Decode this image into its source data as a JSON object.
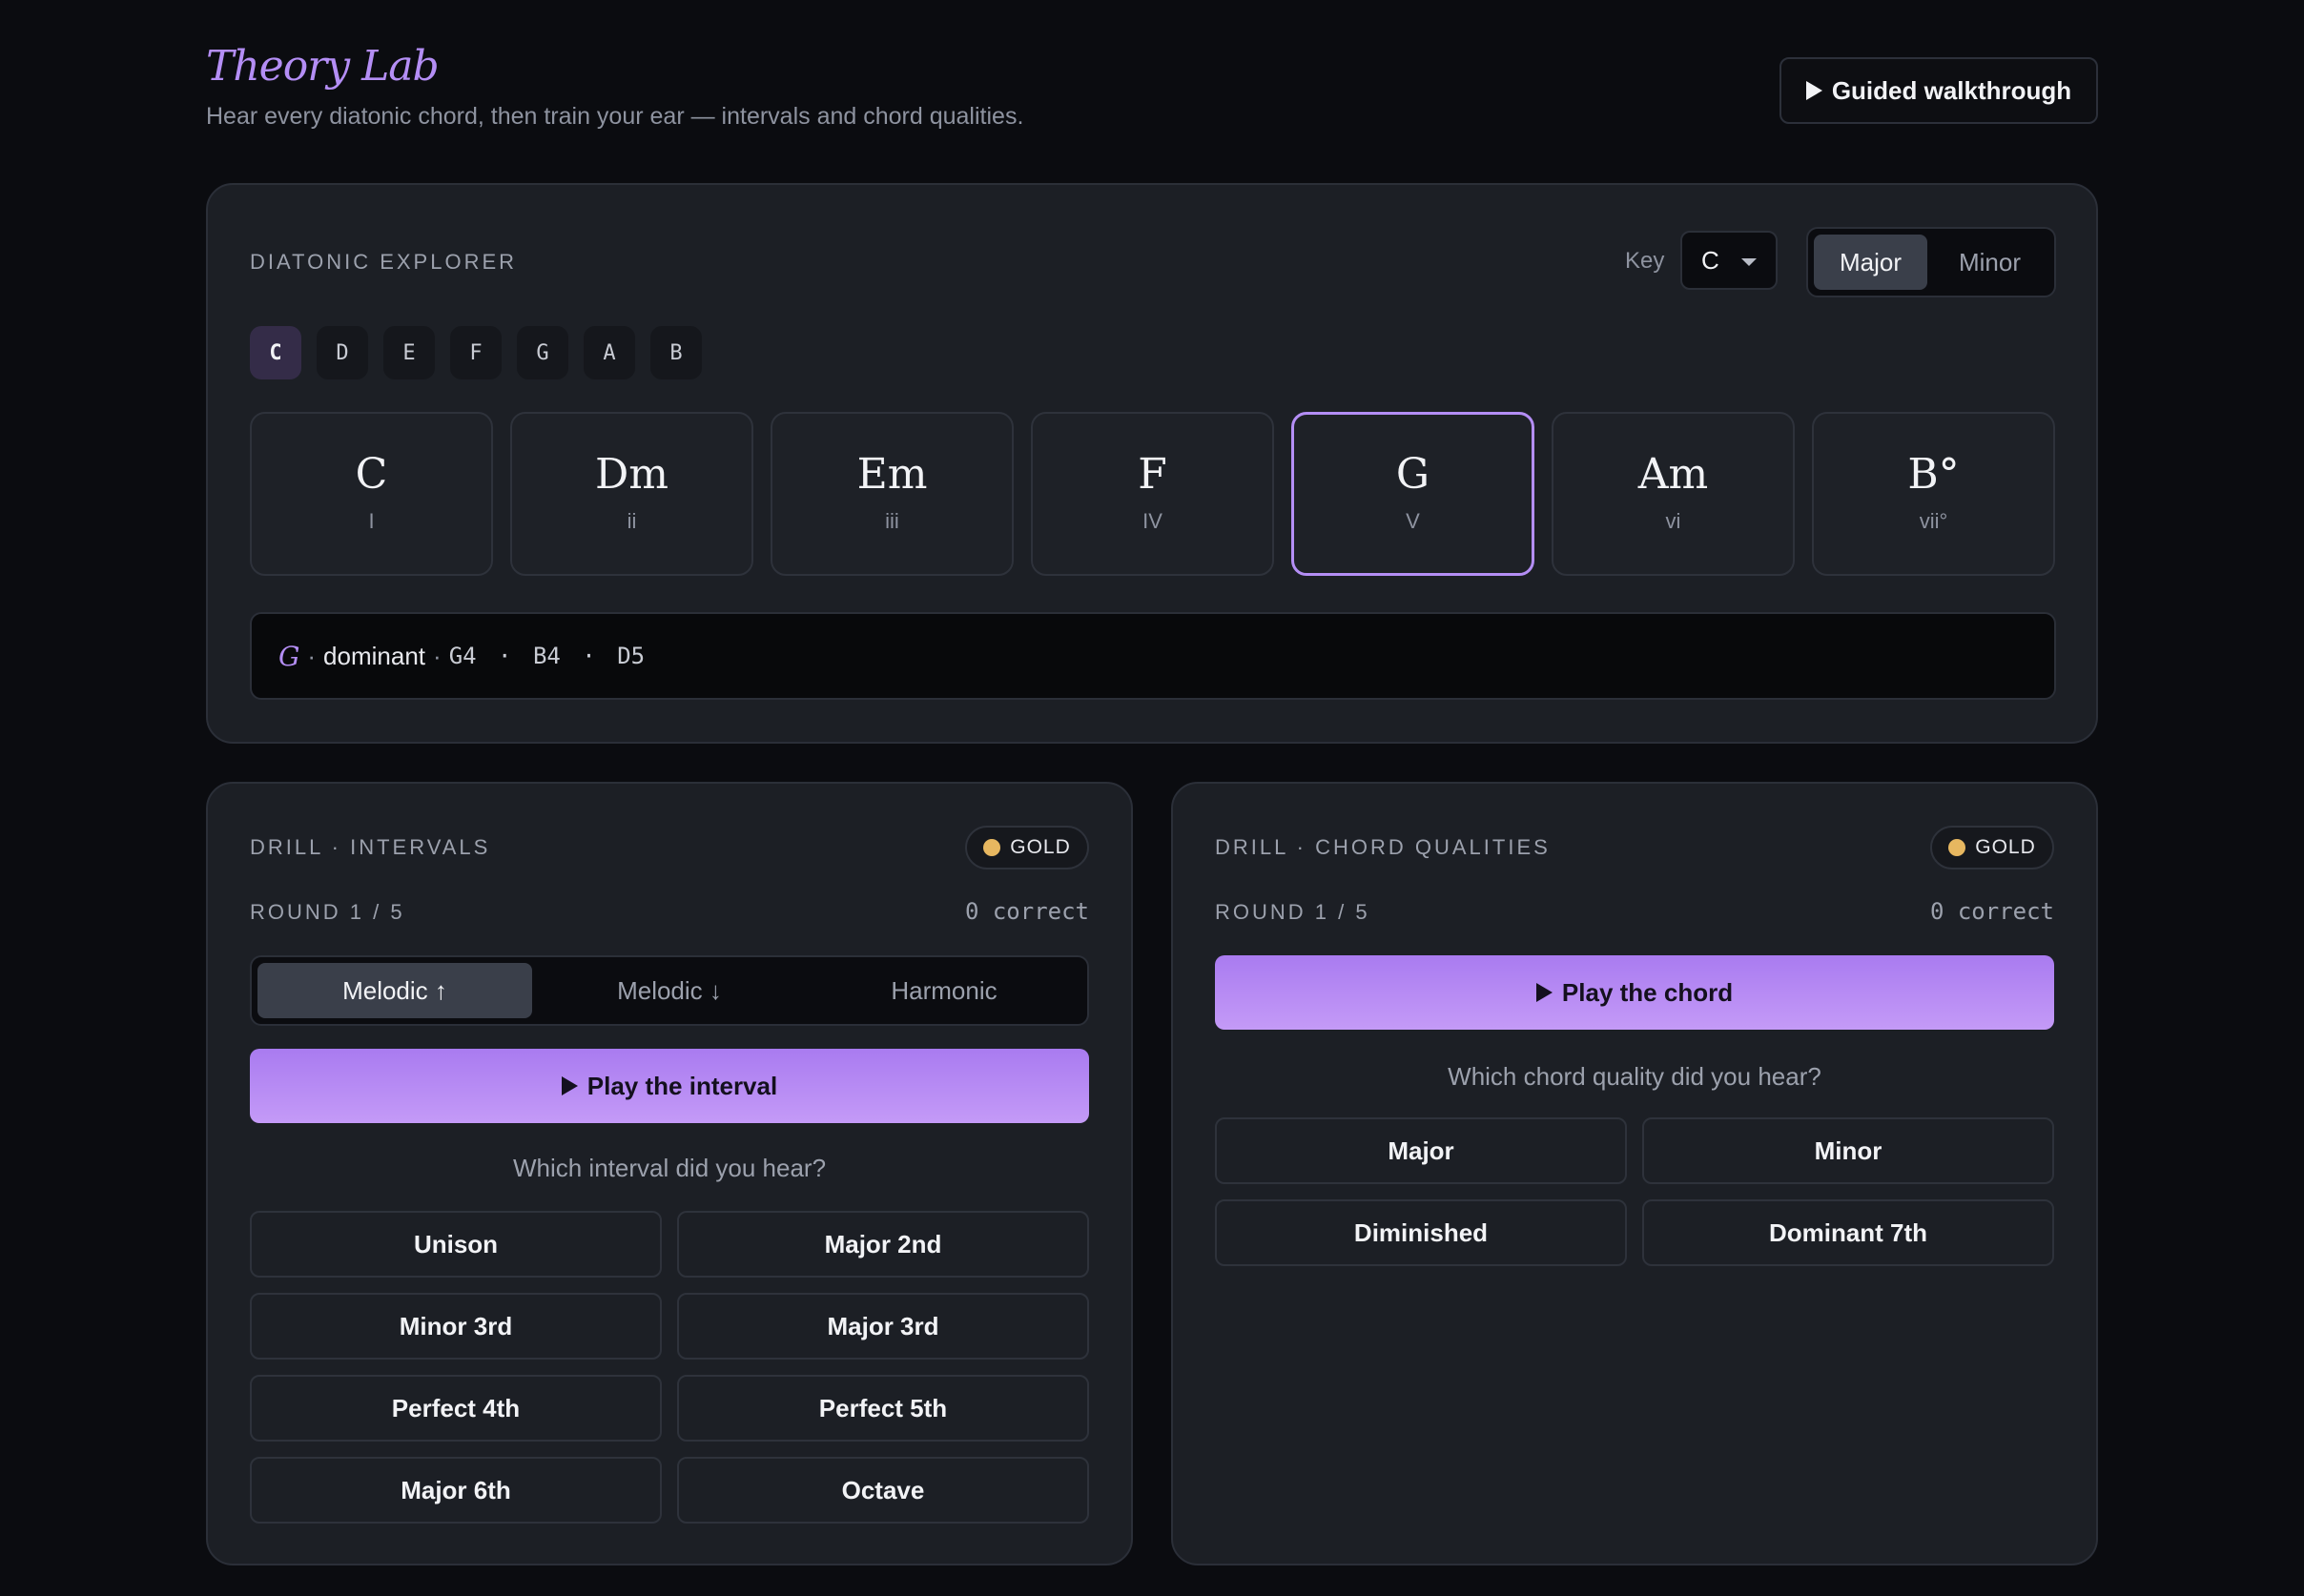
{
  "header": {
    "title": "Theory Lab",
    "subtitle": "Hear every diatonic chord, then train your ear — intervals and chord qualities.",
    "walkthrough_label": "Guided walkthrough"
  },
  "explorer": {
    "section_label": "DIATONIC EXPLORER",
    "key_label": "Key",
    "key_value": "C",
    "modes": [
      "Major",
      "Minor"
    ],
    "active_mode": "Major",
    "roots": [
      "C",
      "D",
      "E",
      "F",
      "G",
      "A",
      "B"
    ],
    "active_root": "C",
    "chords": [
      {
        "name": "C",
        "numeral": "I"
      },
      {
        "name": "Dm",
        "numeral": "ii"
      },
      {
        "name": "Em",
        "numeral": "iii"
      },
      {
        "name": "F",
        "numeral": "IV"
      },
      {
        "name": "G",
        "numeral": "V"
      },
      {
        "name": "Am",
        "numeral": "vi"
      },
      {
        "name": "B°",
        "numeral": "vii°"
      }
    ],
    "selected_chord": "G",
    "detail": {
      "chord": "G",
      "function": "dominant",
      "notes": [
        "G4",
        "B4",
        "D5"
      ]
    }
  },
  "drill_intervals": {
    "section_label": "DRILL · INTERVALS",
    "badge": "GOLD",
    "round": "ROUND 1 / 5",
    "correct": "0 correct",
    "directions": [
      "Melodic ↑",
      "Melodic ↓",
      "Harmonic"
    ],
    "active_direction": "Melodic ↑",
    "play_label": "Play the interval",
    "question": "Which interval did you hear?",
    "answers": [
      "Unison",
      "Major 2nd",
      "Minor 3rd",
      "Major 3rd",
      "Perfect 4th",
      "Perfect 5th",
      "Major 6th",
      "Octave"
    ]
  },
  "drill_chords": {
    "section_label": "DRILL · CHORD QUALITIES",
    "badge": "GOLD",
    "round": "ROUND 1 / 5",
    "correct": "0 correct",
    "play_label": "Play the chord",
    "question": "Which chord quality did you hear?",
    "answers": [
      "Major",
      "Minor",
      "Diminished",
      "Dominant 7th"
    ]
  },
  "colors": {
    "accent": "#b48ef5",
    "background": "#0b0c10",
    "card": "#1c1f25",
    "gold": "#e7b760"
  }
}
